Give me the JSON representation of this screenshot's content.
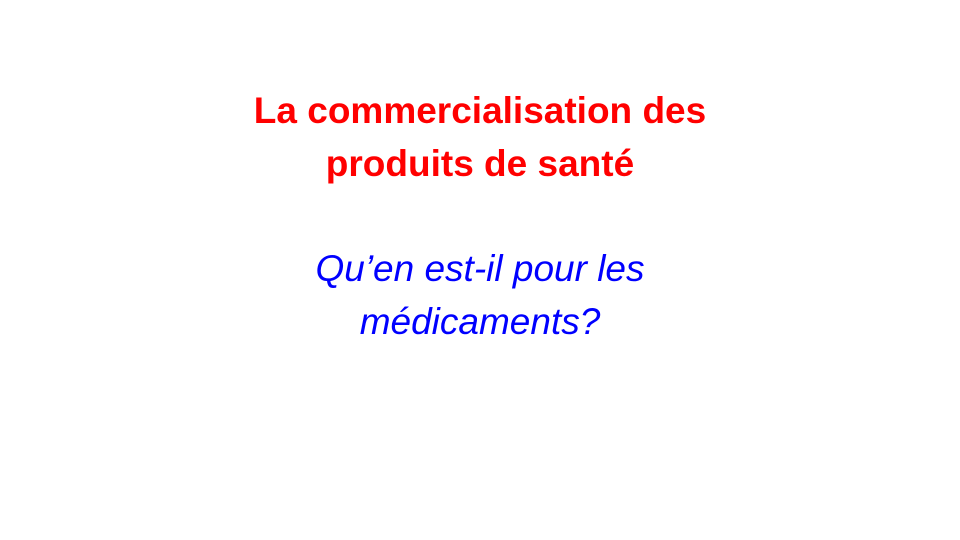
{
  "slide": {
    "title": {
      "lines": [
        "La commercialisation des",
        "produits de santé"
      ],
      "color": "#ff0000"
    },
    "subtitle": {
      "lines": [
        "Qu’en est-il pour les",
        "médicaments?"
      ],
      "color": "#0000ff"
    },
    "background": "#ffffff"
  }
}
